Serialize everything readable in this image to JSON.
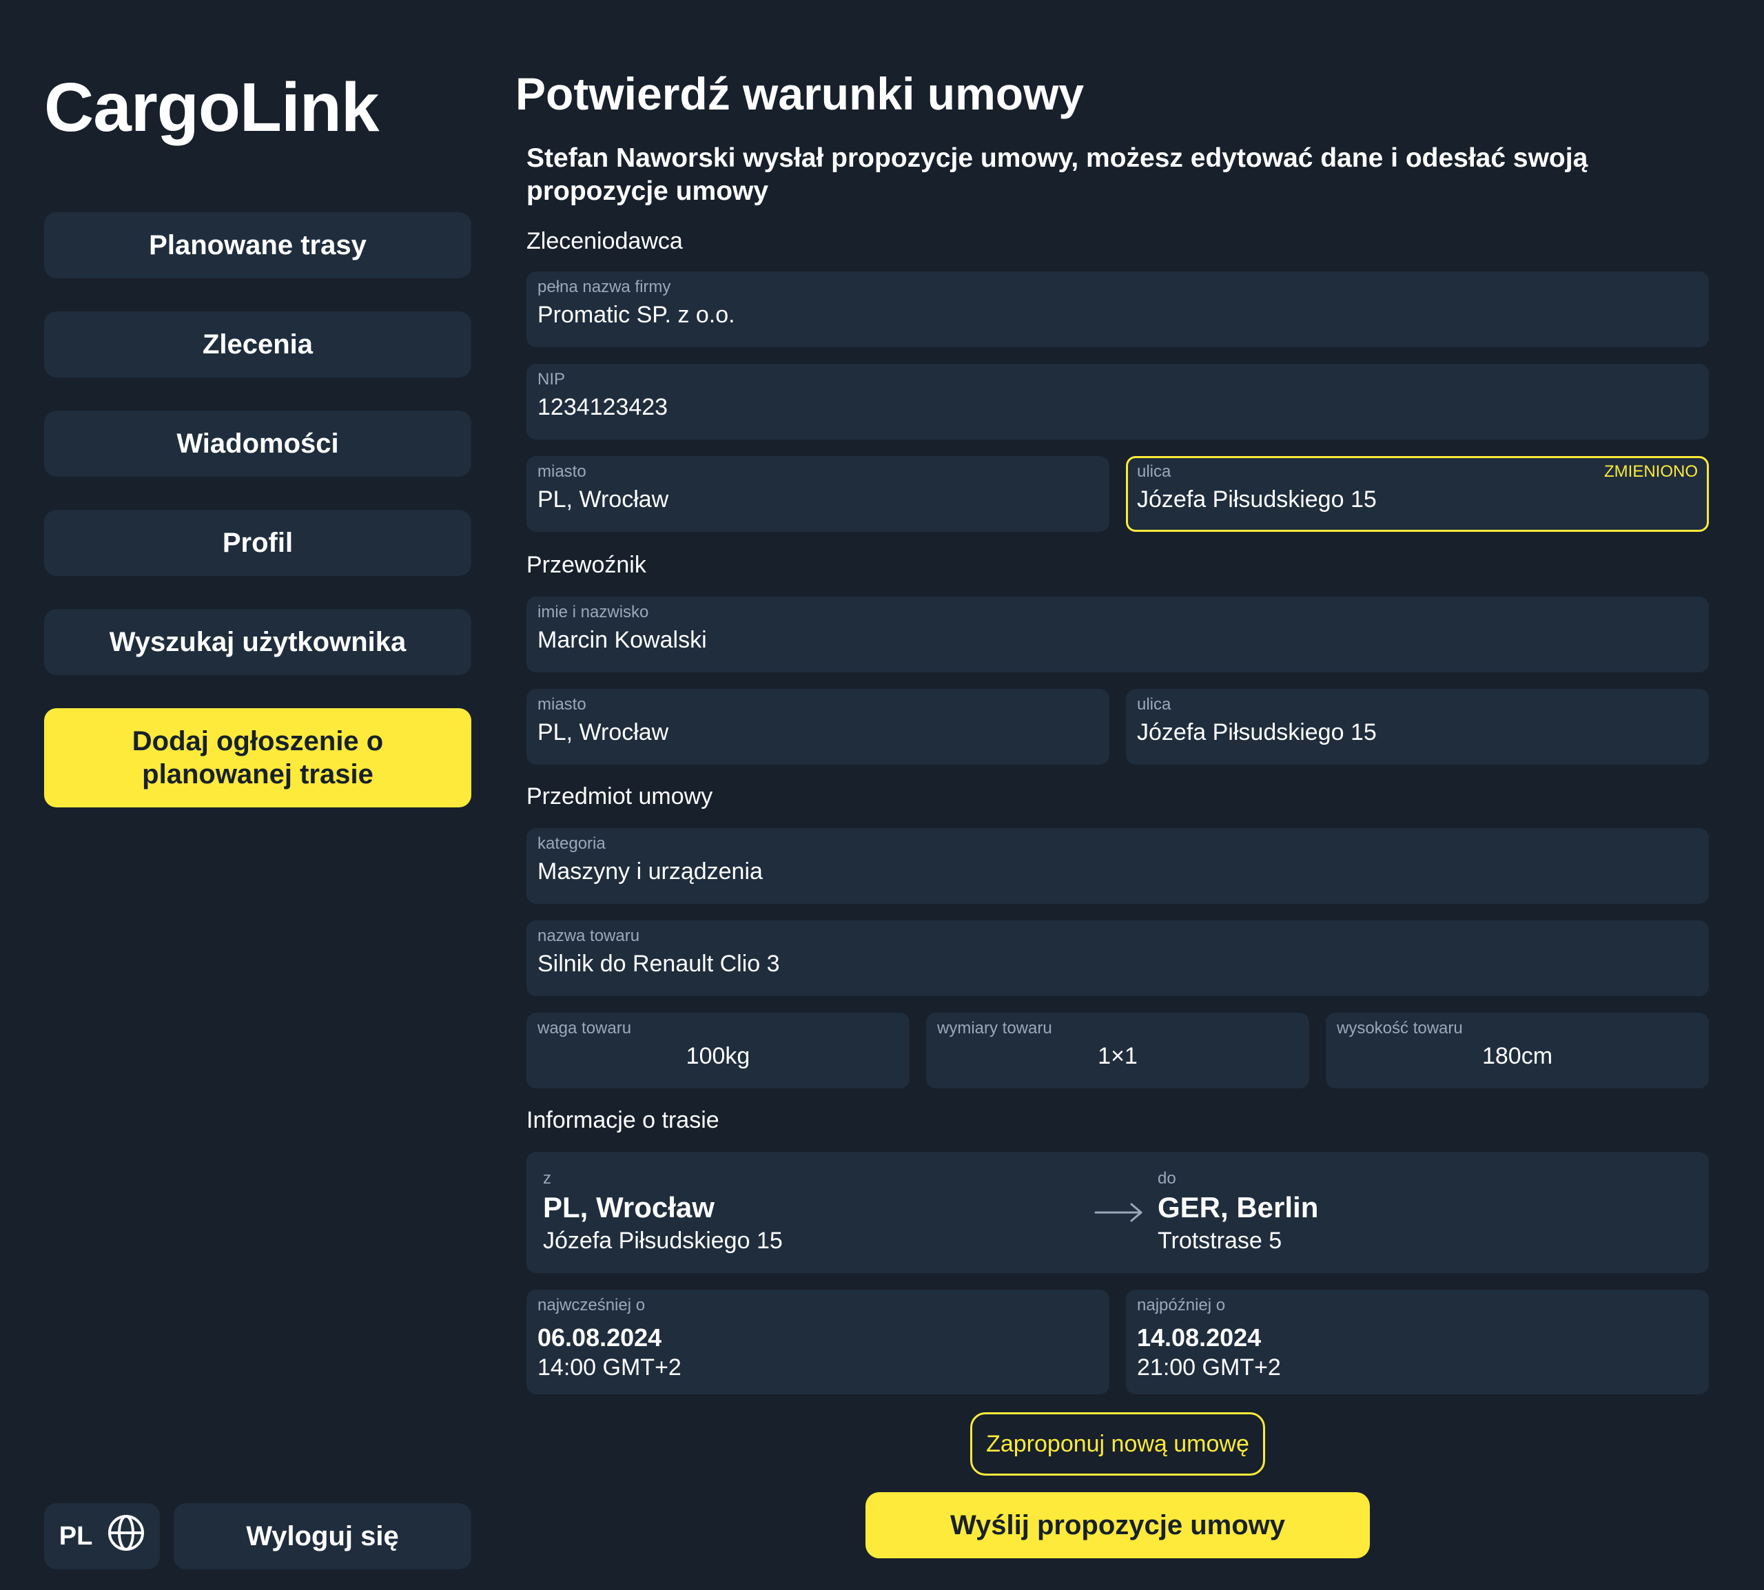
{
  "app": {
    "logo": "CargoLink"
  },
  "sidebar": {
    "items": [
      {
        "label": "Planowane trasy"
      },
      {
        "label": "Zlecenia"
      },
      {
        "label": "Wiadomości"
      },
      {
        "label": "Profil"
      },
      {
        "label": "Wyszukaj użytkownika"
      }
    ],
    "cta_label": "Dodaj ogłoszenie o planowanej trasie",
    "language": "PL",
    "logout_label": "Wyloguj się"
  },
  "main": {
    "title": "Potwierdź warunki umowy",
    "intro": "Stefan Naworski wysłał propozycje umowy, możesz edytować dane i odesłać swoją propozycje umowy",
    "client": {
      "section": "Zleceniodawca",
      "company": {
        "label": "pełna nazwa firmy",
        "value": "Promatic SP. z o.o."
      },
      "nip": {
        "label": "NIP",
        "value": "1234123423"
      },
      "city": {
        "label": "miasto",
        "value": "PL, Wrocław"
      },
      "street": {
        "label": "ulica",
        "value": "Józefa Piłsudskiego 15",
        "tag": "ZMIENIONO"
      }
    },
    "carrier": {
      "section": "Przewoźnik",
      "name": {
        "label": "imie i nazwisko",
        "value": "Marcin Kowalski"
      },
      "city": {
        "label": "miasto",
        "value": "PL, Wrocław"
      },
      "street": {
        "label": "ulica",
        "value": "Józefa Piłsudskiego 15"
      }
    },
    "subject": {
      "section": "Przedmiot umowy",
      "category": {
        "label": "kategoria",
        "value": "Maszyny i urządzenia"
      },
      "goods": {
        "label": "nazwa towaru",
        "value": "Silnik do Renault Clio 3"
      },
      "weight": {
        "label": "waga towaru",
        "value": "100kg"
      },
      "dimensions": {
        "label": "wymiary towaru",
        "value": "1×1"
      },
      "height": {
        "label": "wysokość towaru",
        "value": "180cm"
      }
    },
    "route": {
      "section": "Informacje o trasie",
      "from": {
        "label": "z",
        "city": "PL, Wrocław",
        "street": "Józefa Piłsudskiego 15"
      },
      "to": {
        "label": "do",
        "city": "GER, Berlin",
        "street": "Trotstrase 5"
      },
      "earliest": {
        "label": "najwcześniej o",
        "date": "06.08.2024",
        "time": "14:00 GMT+2"
      },
      "latest": {
        "label": "najpóźniej o",
        "date": "14.08.2024",
        "time": "21:00 GMT+2"
      }
    },
    "actions": {
      "propose_label": "Zaproponuj nową umowę",
      "send_label": "Wyślij propozycje umowy"
    }
  },
  "colors": {
    "background": "#17202b",
    "panel": "#1f2d3d",
    "accent": "#fdea3b",
    "muted": "#9aa8ba"
  }
}
